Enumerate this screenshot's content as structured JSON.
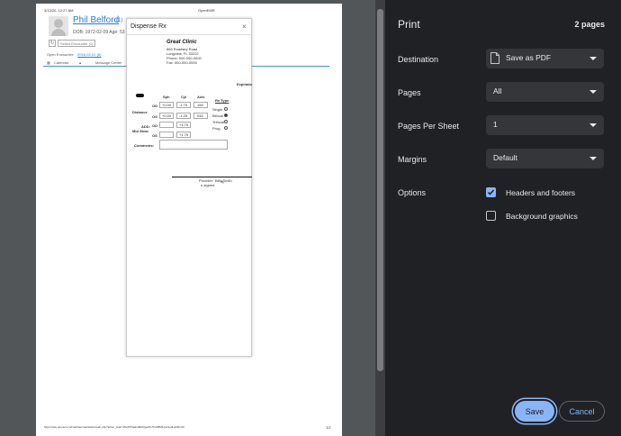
{
  "preview": {
    "header_left": "3/13/20, 12:27 AM",
    "header_center": "OpenEMR",
    "patient_name": "Phil Belford",
    "patient_suffix": "(1)",
    "dob_line": "DOB: 1972-02-09 Age: 53",
    "select_encounter": "Select Encounter (1)",
    "open_encounter_label": "Open Encounter:",
    "open_encounter_date": "2016-02-01 (6)",
    "nav_calendar": "Calendar",
    "nav_message": "Message Center",
    "footer_url": "https://ode.openemr.io/interface/main/tabs/main.php?token_main=2beM73a2od0t2Qgu0CJTuOBMiUunUedLaCRmzF",
    "footer_page": "1/2",
    "dialog": {
      "title": "Dispense Rx",
      "close": "×",
      "clinic_name": "Great Clinic",
      "clinic_address": "665 Roadsby Road",
      "clinic_city": "Longview, FL 33222",
      "clinic_phone": "Phone: 000-000-0000",
      "clinic_fax": "Fax: 000-000-0000",
      "expiration": "Expiratio",
      "col_sph": "Sph",
      "col_cyl": "Cyl",
      "col_axis": "Axis",
      "col_rx_type": "Rx Type",
      "distance": "Distance",
      "od": "OD",
      "os": "OS",
      "od_sph": "+0.00",
      "od_cyl": "-1.75",
      "od_axis": "155",
      "os_sph": "+0.00",
      "os_cyl": "-1.25",
      "os_axis": "045",
      "add_label": "ADD:",
      "mid_near": "Mid /Near",
      "add_od": "+1.75",
      "add_os": "+1.75",
      "single": "Single",
      "bifocal": "Bifocal",
      "trifocal": "Trifocal",
      "prog": "Prog.",
      "comments": "Comments:",
      "provider": "Provider:",
      "provider_name": "Billy Smith",
      "e_signed": "e-signed"
    }
  },
  "print": {
    "title": "Print",
    "pages_count": "2 pages",
    "destination_label": "Destination",
    "destination_value": "Save as PDF",
    "pages_label": "Pages",
    "pages_value": "All",
    "per_sheet_label": "Pages Per Sheet",
    "per_sheet_value": "1",
    "margins_label": "Margins",
    "margins_value": "Default",
    "options_label": "Options",
    "headers_footers": "Headers and footers",
    "headers_footers_checked": true,
    "background_graphics": "Background graphics",
    "background_graphics_checked": false,
    "save": "Save",
    "cancel": "Cancel"
  },
  "colors": {
    "accent": "#8ab4f8",
    "panel_bg": "#202124",
    "select_bg": "#35363a",
    "preview_bg": "#525659",
    "link": "#1a73e8"
  },
  "icons": {
    "destination": "pdf-file-icon",
    "select": "chevron-down-icon",
    "checkbox": "check-icon"
  }
}
